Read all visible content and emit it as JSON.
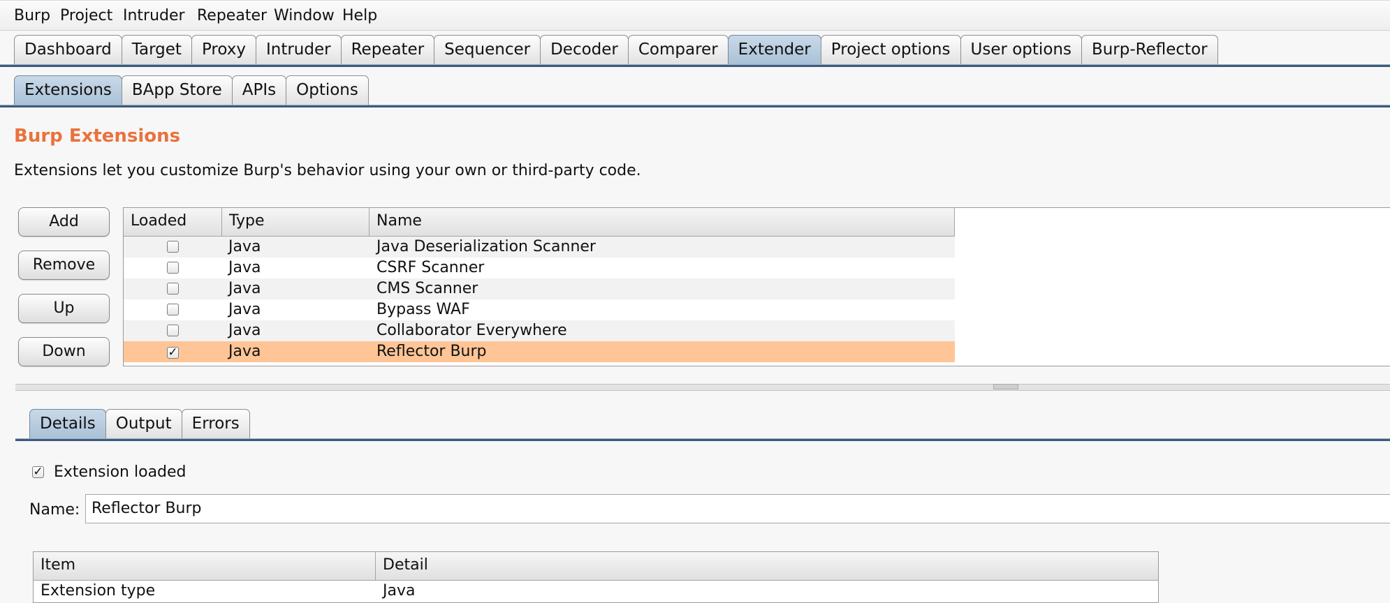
{
  "menu": [
    "Burp",
    "Project",
    "Intruder",
    "Repeater",
    "Window",
    "Help"
  ],
  "main_tabs": [
    "Dashboard",
    "Target",
    "Proxy",
    "Intruder",
    "Repeater",
    "Sequencer",
    "Decoder",
    "Comparer",
    "Extender",
    "Project options",
    "User options",
    "Burp-Reflector"
  ],
  "main_active": "Extender",
  "sub_tabs": [
    "Extensions",
    "BApp Store",
    "APIs",
    "Options"
  ],
  "sub_active": "Extensions",
  "section": {
    "title": "Burp Extensions",
    "description": "Extensions let you customize Burp's behavior using your own or third-party code."
  },
  "buttons": {
    "add": "Add",
    "remove": "Remove",
    "up": "Up",
    "down": "Down"
  },
  "ext_table": {
    "headers": [
      "Loaded",
      "Type",
      "Name"
    ],
    "rows": [
      {
        "loaded": false,
        "type": "Java",
        "name": "Java Deserialization Scanner"
      },
      {
        "loaded": false,
        "type": "Java",
        "name": "CSRF Scanner"
      },
      {
        "loaded": false,
        "type": "Java",
        "name": "CMS Scanner"
      },
      {
        "loaded": false,
        "type": "Java",
        "name": "Bypass WAF"
      },
      {
        "loaded": false,
        "type": "Java",
        "name": "Collaborator Everywhere"
      },
      {
        "loaded": true,
        "type": "Java",
        "name": "Reflector Burp",
        "selected": true
      }
    ]
  },
  "detail_tabs": [
    "Details",
    "Output",
    "Errors"
  ],
  "detail_active": "Details",
  "details": {
    "extension_loaded_label": "Extension loaded",
    "extension_loaded": true,
    "name_label": "Name:",
    "name_value": "Reflector Burp",
    "table_headers": [
      "Item",
      "Detail"
    ],
    "table_rows": [
      {
        "item": "Extension type",
        "detail": "Java"
      }
    ]
  },
  "colors": {
    "accent": "#e9723d",
    "selected_row": "#ffc596",
    "active_tab": "#a9c1d7",
    "stripe": "#f2f2f2"
  }
}
